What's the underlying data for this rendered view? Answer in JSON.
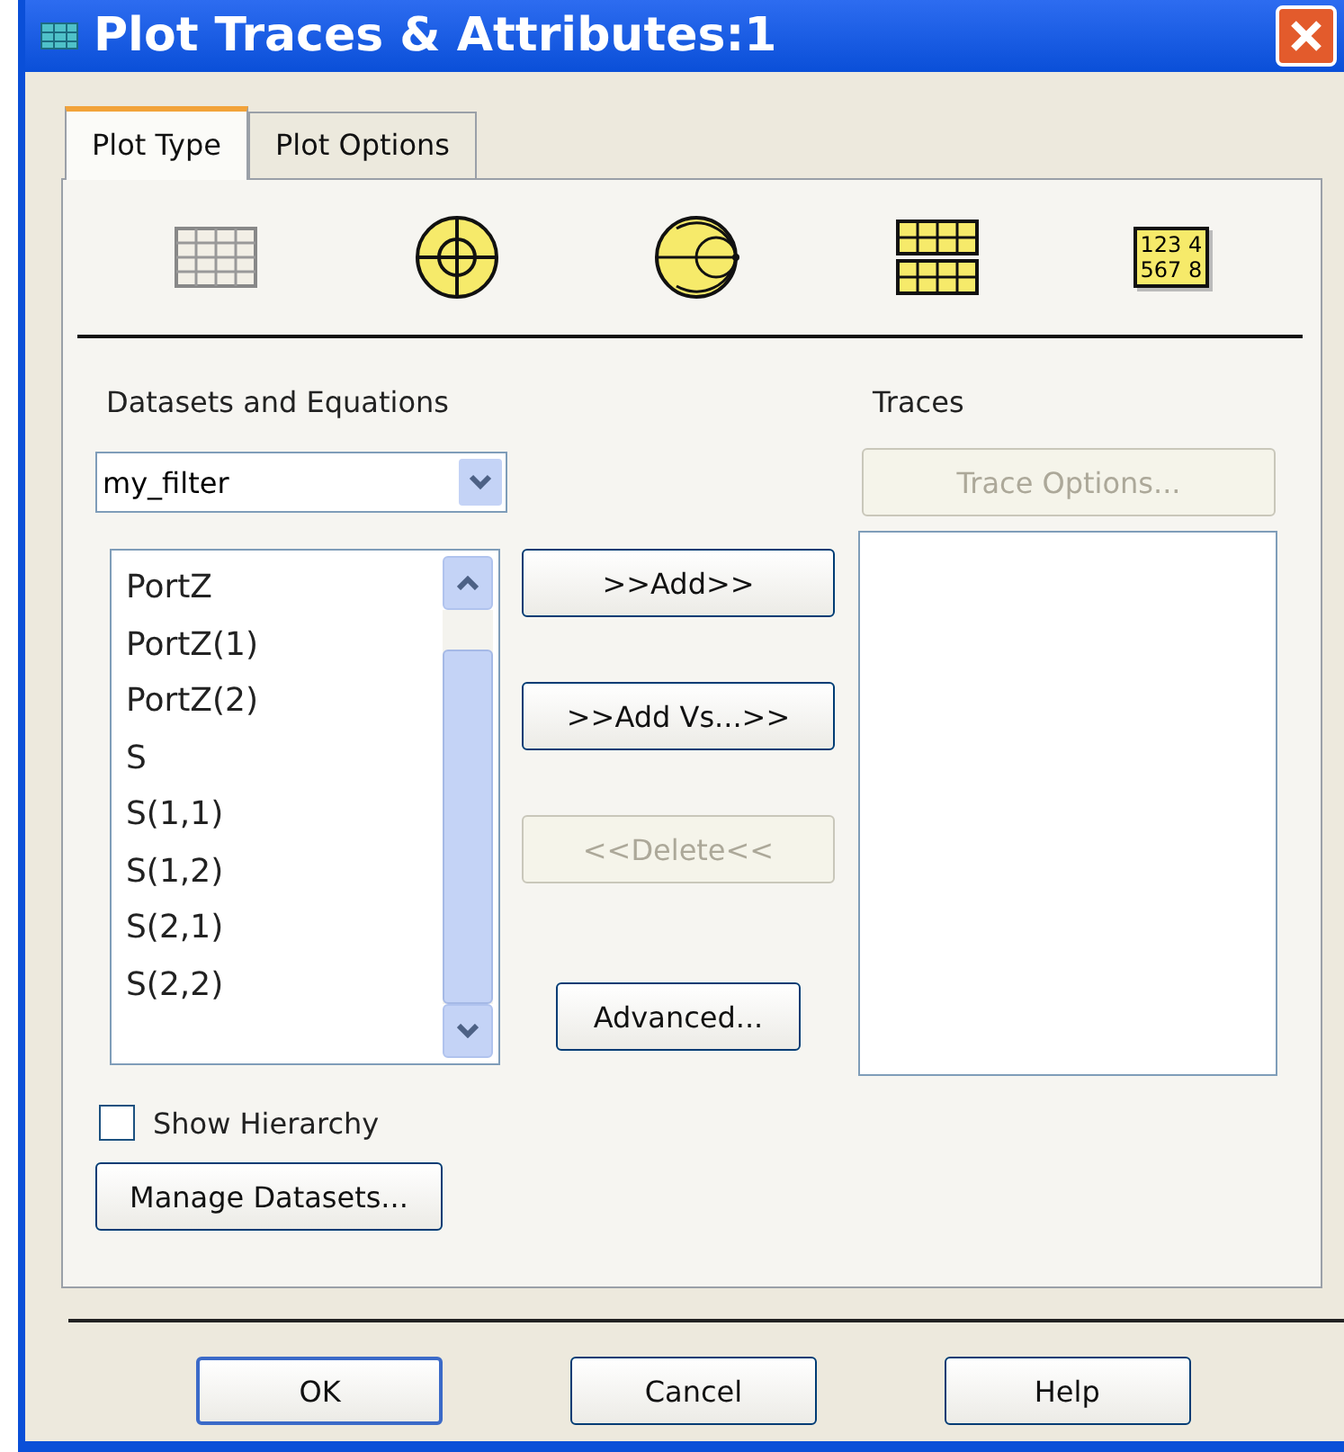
{
  "window": {
    "title": "Plot Traces & Attributes:1"
  },
  "tabs": [
    {
      "label": "Plot Type",
      "selected": true
    },
    {
      "label": "Plot Options",
      "selected": false
    }
  ],
  "plot_types": [
    {
      "kind": "grid"
    },
    {
      "kind": "polar"
    },
    {
      "kind": "smith"
    },
    {
      "kind": "stacked"
    },
    {
      "kind": "list",
      "lines": [
        "123 4",
        "567 8"
      ]
    }
  ],
  "datasets": {
    "label": "Datasets and Equations",
    "dataset": "my_filter",
    "items": [
      "PortZ",
      "PortZ(1)",
      "PortZ(2)",
      "S",
      "S(1,1)",
      "S(1,2)",
      "S(2,1)",
      "S(2,2)"
    ]
  },
  "middle_buttons": [
    {
      "label": ">>Add>>",
      "disabled": false
    },
    {
      "label": ">>Add Vs...>>",
      "disabled": false
    },
    {
      "label": "<<Delete<<",
      "disabled": true
    },
    {
      "label": "Advanced...",
      "disabled": false
    }
  ],
  "traces": {
    "label": "Traces",
    "options_button": {
      "label": "Trace Options...",
      "disabled": true
    }
  },
  "show_hierarchy": {
    "label": "Show Hierarchy",
    "checked": false
  },
  "manage_button": "Manage Datasets...",
  "buttons": [
    "OK",
    "Cancel",
    "Help"
  ]
}
